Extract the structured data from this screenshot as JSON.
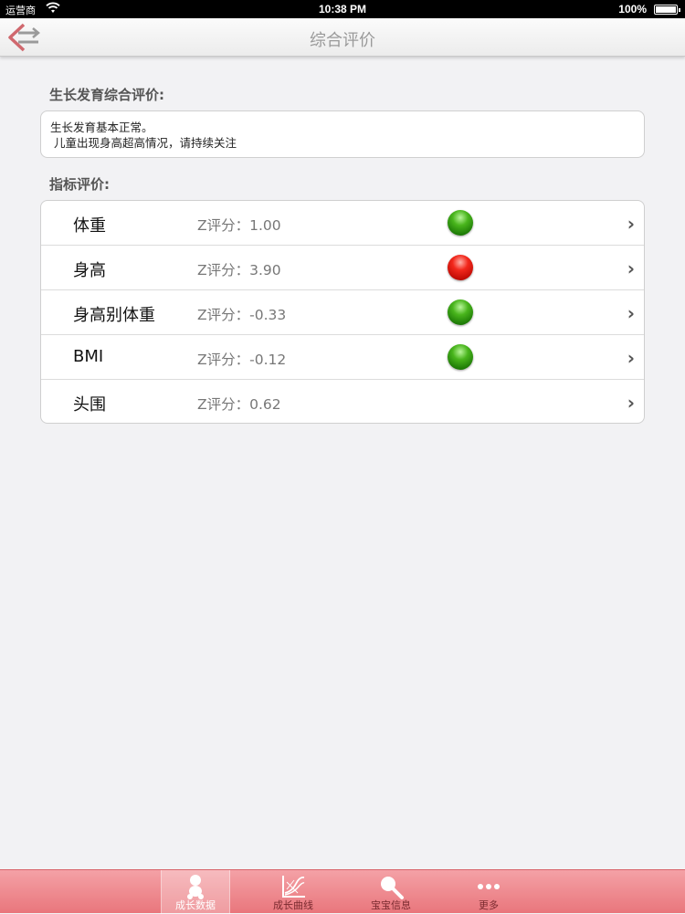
{
  "status": {
    "carrier": "运营商",
    "time": "10:38 PM",
    "battery": "100%"
  },
  "nav": {
    "title": "综合评价",
    "back_icon": "back-arrow-icon"
  },
  "summary": {
    "label": "生长发育综合评价:",
    "line1": "生长发育基本正常。",
    "line2": " 儿童出现身高超高情况，请持续关注"
  },
  "indicators": {
    "label": "指标评价:",
    "rows": [
      {
        "name": "体重",
        "score": "Z评分：1.00",
        "status": "green"
      },
      {
        "name": "身高",
        "score": "Z评分：3.90",
        "status": "red"
      },
      {
        "name": "身高别体重",
        "score": "Z评分：-0.33",
        "status": "green"
      },
      {
        "name": "BMI",
        "score": "Z评分：-0.12",
        "status": "green"
      },
      {
        "name": "头围",
        "score": "Z评分：0.62",
        "status": ""
      }
    ],
    "chevron": "›"
  },
  "tabs": [
    {
      "label": "成长数据",
      "icon": "baby-icon",
      "active": true
    },
    {
      "label": "成长曲线",
      "icon": "chart-icon",
      "active": false
    },
    {
      "label": "宝宝信息",
      "icon": "search-icon",
      "active": false
    },
    {
      "label": "更多",
      "icon": "more-dots-icon",
      "active": false
    }
  ],
  "colors": {
    "accent": "#e9767c",
    "green": "#2a9a0e",
    "red": "#e0160b"
  }
}
